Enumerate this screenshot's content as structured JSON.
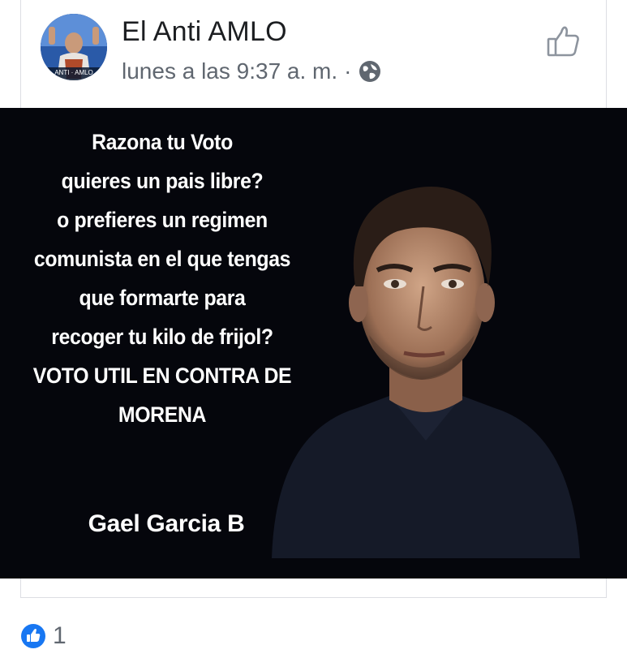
{
  "post": {
    "author": "El Anti AMLO",
    "timestamp": "lunes a las 9:37 a. m.",
    "separator": "·",
    "avatar_text": "ANTI · AMLO"
  },
  "image": {
    "quote_lines": [
      "Razona tu Voto",
      "quieres un pais libre?",
      "o prefieres un regimen",
      "comunista en el que tengas",
      "que formarte para",
      "recoger tu kilo de frijol?",
      "VOTO UTIL EN CONTRA DE",
      "MORENA"
    ],
    "signature": "Gael Garcia B"
  },
  "reactions": {
    "count": "1",
    "icon": "like-reaction-icon"
  },
  "colors": {
    "brand_blue": "#1877f2",
    "image_bg": "#05060c",
    "meta_gray": "#606770"
  }
}
